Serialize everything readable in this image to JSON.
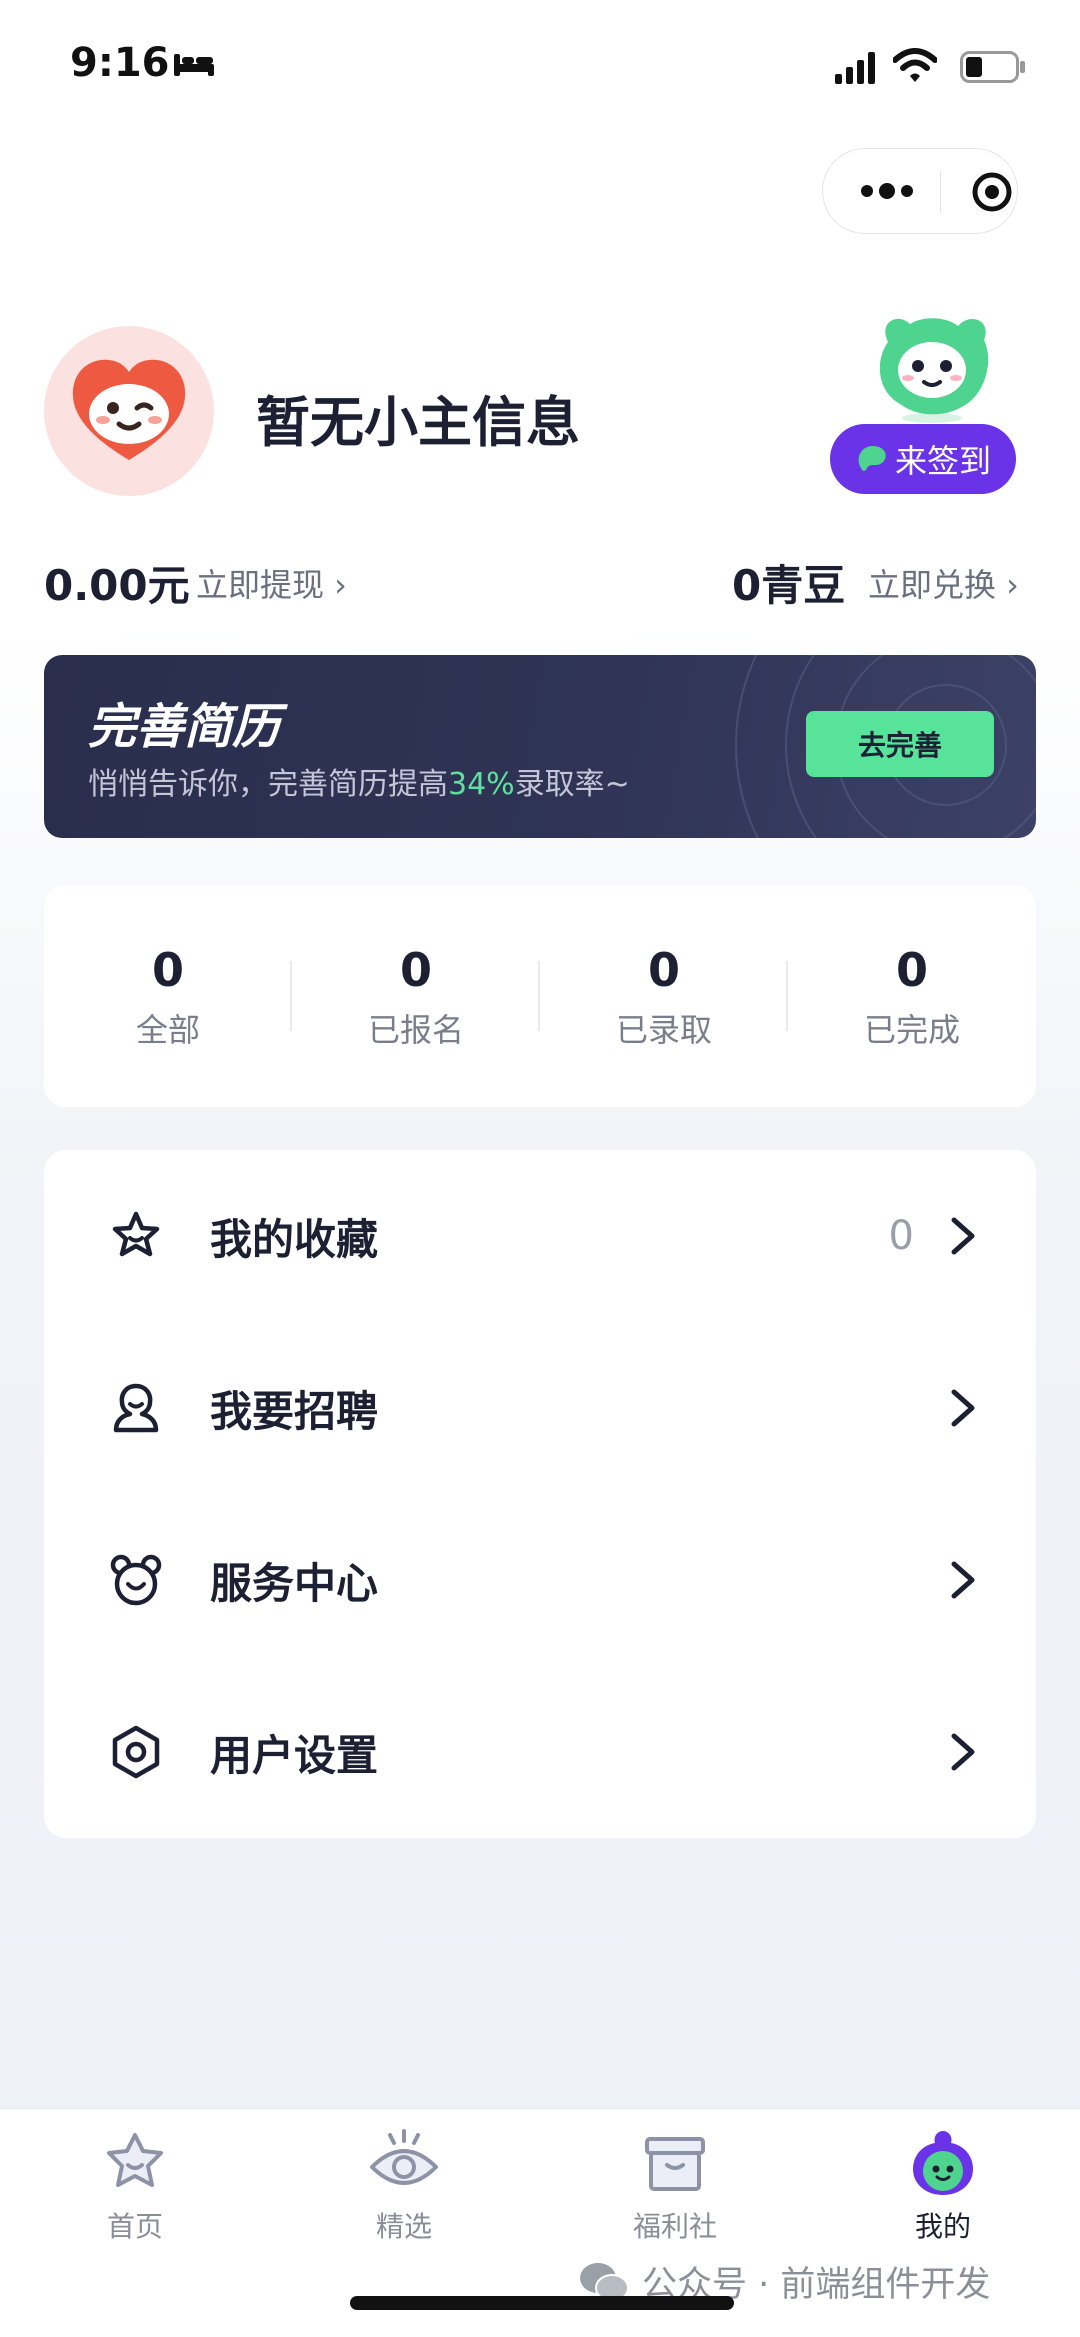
{
  "status_bar": {
    "time": "9:16"
  },
  "profile": {
    "name": "暂无小主信息",
    "signin_label": "来签到"
  },
  "balance": {
    "money": "0.00元",
    "withdraw": "立即提现 ›",
    "beans": "0青豆",
    "exchange": "立即兑换 ›"
  },
  "banner": {
    "title": "完善简历",
    "subtitle_prefix": "悄悄告诉你，完善简历提高",
    "subtitle_highlight": "34%",
    "subtitle_suffix": "录取率~",
    "button": "去完善",
    "accent": "#58e39a"
  },
  "stats": [
    {
      "value": "0",
      "label": "全部"
    },
    {
      "value": "0",
      "label": "已报名"
    },
    {
      "value": "0",
      "label": "已录取"
    },
    {
      "value": "0",
      "label": "已完成"
    }
  ],
  "menu": [
    {
      "icon": "star-icon",
      "label": "我的收藏",
      "count": "0"
    },
    {
      "icon": "person-icon",
      "label": "我要招聘",
      "count": ""
    },
    {
      "icon": "bear-face-icon",
      "label": "服务中心",
      "count": ""
    },
    {
      "icon": "settings-hexagon-icon",
      "label": "用户设置",
      "count": ""
    }
  ],
  "tabbar": {
    "tabs": [
      {
        "icon": "star-home-icon",
        "label": "首页",
        "active": false
      },
      {
        "icon": "eye-icon",
        "label": "精选",
        "active": false
      },
      {
        "icon": "gift-box-icon",
        "label": "福利社",
        "active": false
      },
      {
        "icon": "mascot-face-icon",
        "label": "我的",
        "active": true
      }
    ],
    "active_color": "#6a33e8"
  },
  "watermark": "公众号 · 前端组件开发",
  "colors": {
    "brand_purple": "#6a33e8",
    "banner_dark": "#2a2e4c",
    "text_dark": "#1d2033"
  }
}
